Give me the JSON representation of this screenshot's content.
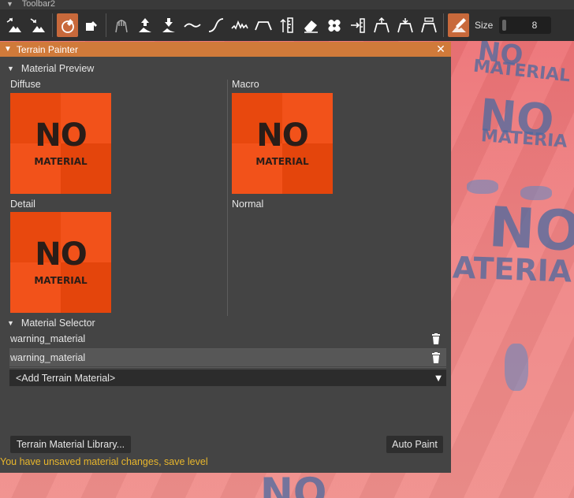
{
  "toolbar": {
    "window_title": "Toolbar2",
    "size_label": "Size",
    "size_value": "8",
    "tools": [
      {
        "icon": "raise-terrain-icon",
        "active": false
      },
      {
        "icon": "lower-terrain-icon",
        "active": false
      },
      {
        "icon": "paint-brush-icon",
        "active": true
      },
      {
        "icon": "eraser-brush-icon",
        "active": false
      },
      {
        "icon": "sculpt-hand-icon",
        "active": false
      },
      {
        "icon": "raise-arrow-icon",
        "active": false
      },
      {
        "icon": "lower-arrow-icon",
        "active": false
      },
      {
        "icon": "smooth-curve-icon",
        "active": false
      },
      {
        "icon": "s-curve-icon",
        "active": false
      },
      {
        "icon": "noise-icon",
        "active": false
      },
      {
        "icon": "plateau-icon",
        "active": false
      },
      {
        "icon": "height-ruler-icon",
        "active": false
      },
      {
        "icon": "eraser-icon",
        "active": false
      },
      {
        "icon": "bandage-icon",
        "active": false
      },
      {
        "icon": "set-height-icon",
        "active": false
      },
      {
        "icon": "flatten-up-icon",
        "active": false
      },
      {
        "icon": "flatten-down-icon",
        "active": false
      },
      {
        "icon": "flatten-level-icon",
        "active": false
      },
      {
        "icon": "paint-material-icon",
        "active": true
      }
    ]
  },
  "panel": {
    "title": "Terrain Painter",
    "preview": {
      "heading": "Material Preview",
      "slots": {
        "diffuse": {
          "label": "Diffuse",
          "thumb_line1": "NO",
          "thumb_line2": "MATERIAL"
        },
        "macro": {
          "label": "Macro",
          "thumb_line1": "NO",
          "thumb_line2": "MATERIAL"
        },
        "detail": {
          "label": "Detail",
          "thumb_line1": "NO",
          "thumb_line2": "MATERIAL"
        },
        "normal": {
          "label": "Normal"
        }
      }
    },
    "selector": {
      "heading": "Material Selector",
      "materials": [
        {
          "name": "warning_material"
        },
        {
          "name": "warning_material"
        }
      ],
      "add_label": "<Add Terrain Material>"
    },
    "library_button": "Terrain Material Library...",
    "auto_paint_button": "Auto Paint",
    "warning": "You have unsaved material changes, save level"
  },
  "viewport": {
    "texture_words": [
      "NO",
      "MATERIAL",
      "NO",
      "MATERIA",
      "NO",
      "ATERIA",
      "NO"
    ]
  },
  "colors": {
    "accent": "#d07a3a",
    "panel_bg": "#444444",
    "toolbar_bg": "#2f2f2f",
    "warning_text": "#e8b62c",
    "thumb_orange": "#f2521a"
  }
}
